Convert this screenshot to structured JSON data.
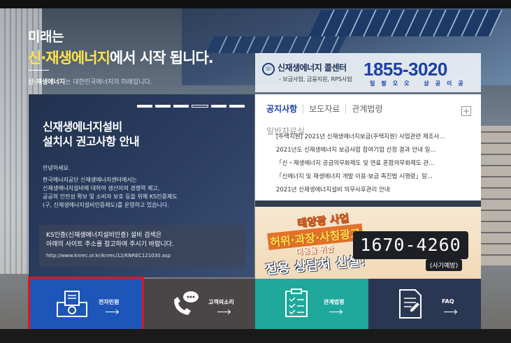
{
  "hero": {
    "line1": "미래는",
    "line2_highlight": "신·재생에너지",
    "line2_rest": "에서 시작 됩니다.",
    "sub_bold": "신·재생에너지",
    "sub_rest": "는 대한민국에너지의 미래입니다."
  },
  "call_center": {
    "icon": "phone-icon",
    "title": "신재생에너지 콜센터",
    "subtitle": "- 보급사업, 금융지원, RPS사업",
    "number": "1855-3020",
    "number_korean": "일팔오오 삼공이공"
  },
  "info_card": {
    "title_line1": "신재생에너지설비",
    "title_line2": "설치시 권고사항 안내",
    "greeting": "안녕하세요.",
    "body": [
      "한국에너지공단 신재생에너지센터에서는",
      "신재생에너지설비에 대하여 생산자의 경쟁력 제고,",
      "공공의 안전성 확보 및 소비자 보호 등을 위해 KS인증제도",
      "(구, 신재생에너지설비인증제도)를 운영하고 있습니다."
    ],
    "ks_line1": "KS인증(신재생에너지설비인증) 설비 검색은",
    "ks_line2": "아래의 사이트 주소를 참고하여 주시기 바랍니다.",
    "ks_url": "http://www.knrec.or.kr/knrec/12/KNREC121030.asp"
  },
  "notice": {
    "tabs": [
      "공지사항",
      "보도자료",
      "관계법령"
    ],
    "tab_row2": "일반자료실",
    "more": "+",
    "items": [
      "[주택지원] 2021년 신재생에너지보급(주택지원) 사업관련 제조사...",
      "2021년도 신재생에너지 보급사업 참여기업 선정 결과 안내 일...",
      "「신・재생에너지 공급의무화제도 및 연료 혼합의무화제도 관...",
      "「신에너지 및 재생에너지 개발·이용·보급 촉진법 시행령」일...",
      "2021년 신재생에너지설비 의무사후관리 안내"
    ]
  },
  "banner": {
    "l1": "태양광 사업",
    "l2": "허위·과장·사칭광고",
    "l3": "대응을 위한",
    "l4": "전용 상담처 신설!",
    "phone": "1670-4260",
    "tag": "(사기예방)"
  },
  "tiles": [
    {
      "label": "전자민원",
      "icon": "document-icon",
      "color": "#1e55b8"
    },
    {
      "label": "고객의소리",
      "icon": "phone-chat-icon",
      "color": "#4a4648"
    },
    {
      "label": "관계법령",
      "icon": "checklist-icon",
      "color": "#1fa89c"
    },
    {
      "label": "FAQ",
      "icon": "faq-document-icon",
      "color": "#2a3752"
    }
  ]
}
